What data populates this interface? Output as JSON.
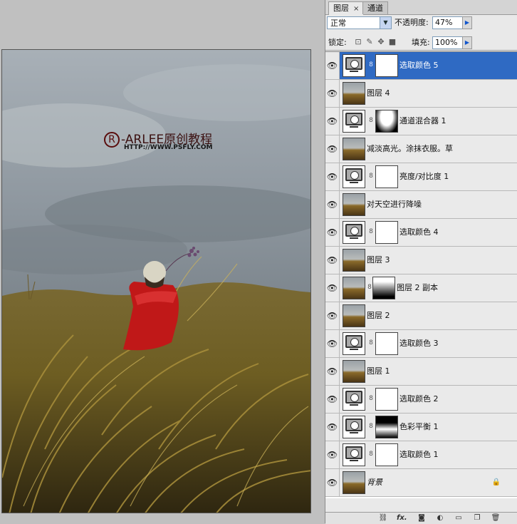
{
  "panel": {
    "tabs": [
      {
        "label": "图层",
        "close": "×"
      },
      {
        "label": "通道"
      }
    ],
    "blend_mode": "正常",
    "opacity_label": "不透明度:",
    "opacity_value": "47%",
    "lock_label": "锁定:",
    "fill_label": "填充:",
    "fill_value": "100%"
  },
  "layers": [
    {
      "name": "选取颜色 5",
      "type": "adjustment",
      "mask": "white",
      "selected": true
    },
    {
      "name": "图层 4",
      "type": "photo"
    },
    {
      "name": "通道混合器 1",
      "type": "adjustment",
      "mask": "channel"
    },
    {
      "name": "减淡高光。涂抹衣服。草",
      "type": "photo"
    },
    {
      "name": "亮度/对比度 1",
      "type": "adjustment",
      "mask": "white"
    },
    {
      "name": "对天空进行降噪",
      "type": "photo"
    },
    {
      "name": "选取颜色 4",
      "type": "adjustment",
      "mask": "white"
    },
    {
      "name": "图层 3",
      "type": "photo"
    },
    {
      "name": "图层 2 副本",
      "type": "photo",
      "mask": "gradient"
    },
    {
      "name": "图层 2",
      "type": "photo"
    },
    {
      "name": "选取颜色 3",
      "type": "adjustment",
      "mask": "white"
    },
    {
      "name": "图层 1",
      "type": "photo"
    },
    {
      "name": "选取颜色 2",
      "type": "adjustment",
      "mask": "white"
    },
    {
      "name": "色彩平衡 1",
      "type": "adjustment",
      "mask": "black"
    },
    {
      "name": "选取颜色 1",
      "type": "adjustment",
      "mask": "white"
    },
    {
      "name": "背景",
      "type": "photo",
      "locked": true
    }
  ],
  "watermark": {
    "logo": "-ARLEE原创教程",
    "url": "HTTP://WWW.PSFLY.COM"
  },
  "icons": [
    "eye-icon",
    "link-chain-icon",
    "lock-icon",
    "fx-icon",
    "mask-icon",
    "adjustment-icon",
    "folder-icon",
    "new-layer-icon",
    "trash-icon"
  ],
  "colors": {
    "selection": "#2f6ac3",
    "panel_bg": "#e9e9e9",
    "canvas_bg": "#c0c0c0"
  }
}
